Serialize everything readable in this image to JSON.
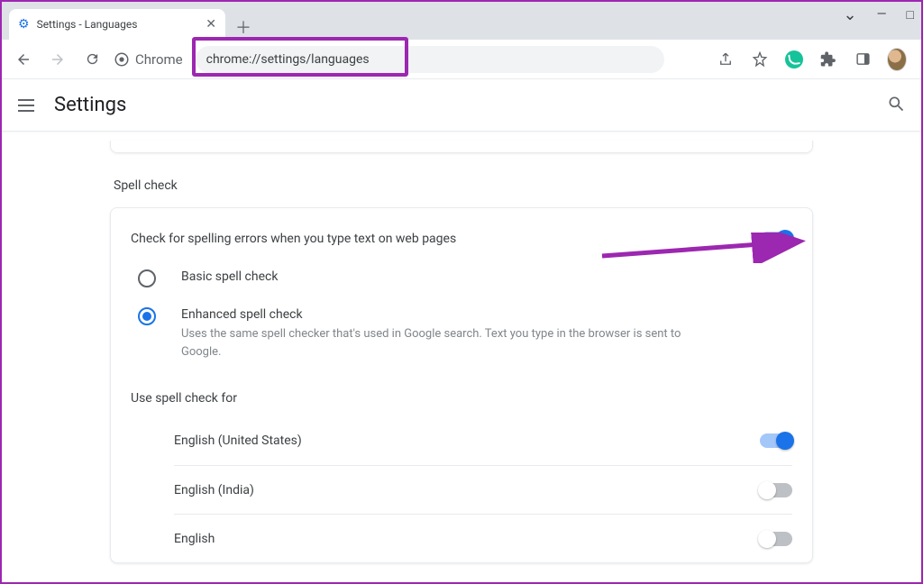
{
  "browser": {
    "tab_title": "Settings - Languages",
    "chrome_label": "Chrome",
    "url": "chrome://settings/languages"
  },
  "app": {
    "title": "Settings"
  },
  "spellcheck": {
    "section_label": "Spell check",
    "toggle_label": "Check for spelling errors when you type text on web pages",
    "toggle_on": true,
    "options": {
      "basic": "Basic spell check",
      "enhanced": "Enhanced spell check",
      "enhanced_desc": "Uses the same spell checker that's used in Google search. Text you type in the browser is sent to Google."
    },
    "use_for_label": "Use spell check for",
    "languages": [
      {
        "name": "English (United States)",
        "on": true
      },
      {
        "name": "English (India)",
        "on": false
      },
      {
        "name": "English",
        "on": false
      }
    ]
  }
}
